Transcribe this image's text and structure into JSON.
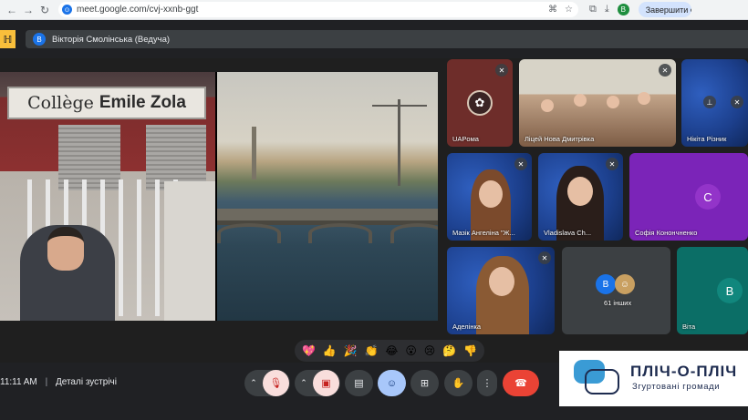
{
  "browser": {
    "url": "meet.google.com/cvj-xxnb-ggt",
    "profile_initial": "B",
    "update_label": "Завершити о"
  },
  "meet": {
    "presenter_initial": "B",
    "presenter_label": "Вікторія Смолінська (Ведуча)",
    "stage": {
      "sign_word1": "Collège",
      "sign_word2": "Emile Zola"
    },
    "tiles": [
      {
        "name": "UAPoма"
      },
      {
        "name": "Ліцей Нова Дмитрівка"
      },
      {
        "name": "Нікіта Різник"
      },
      {
        "name": "Мазік Ангеліна \"Ж..."
      },
      {
        "name": "Vladislava Ch..."
      },
      {
        "name": "Софія Конончненко",
        "initial": "C"
      },
      {
        "name": "Аделінка"
      },
      {
        "name": "61 інших",
        "initial": "B"
      },
      {
        "name": "Віта",
        "initial": "B"
      }
    ],
    "reactions": [
      "💖",
      "👍",
      "🎉",
      "👏",
      "😂",
      "😮",
      "😢",
      "🤔",
      "👎"
    ],
    "time": "11:11 AM",
    "details_label": "Деталі зустрічі"
  },
  "logo": {
    "title": "ПЛІЧ-О-ПЛІЧ",
    "subtitle": "Згуртовані громади"
  },
  "colors": {
    "accent_blue": "#1a73e8",
    "danger": "#ea4335",
    "tile_purple": "#7b24b8",
    "tile_teal": "#0b6e66"
  }
}
